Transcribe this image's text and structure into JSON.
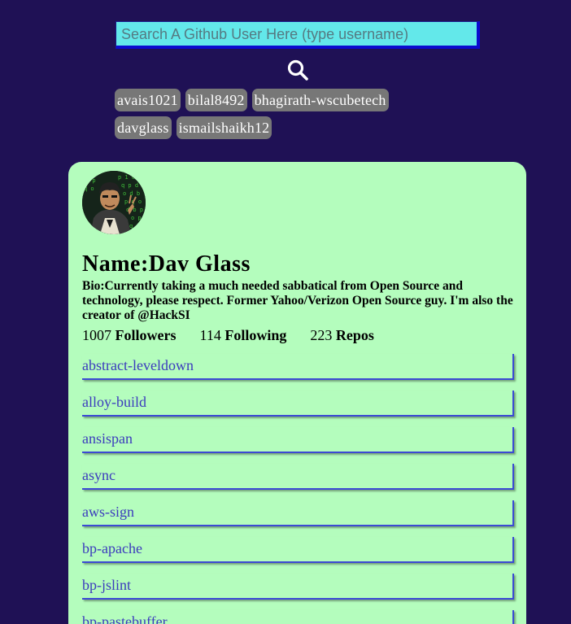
{
  "search": {
    "placeholder": "Search A Github User Here (type username)",
    "button_icon": "magnifier-icon"
  },
  "recent_searches": [
    [
      "avais1021",
      "bilal8492",
      "bhagirath-wscubetech"
    ],
    [
      "davglass",
      "ismailshaikh12"
    ]
  ],
  "profile": {
    "name": "Name:Dav Glass",
    "bio": "Bio:Currently taking a much needed sabbatical from Open Source and technology, please respect. Former Yahoo/Verizon Open Source guy. I'm also the creator of @HackSI",
    "followers_count": "1007",
    "followers_label": "Followers",
    "following_count": "114",
    "following_label": "Following",
    "repos_count": "223",
    "repos_label": "Repos"
  },
  "repos": [
    "abstract-leveldown",
    "alloy-build",
    "ansispan",
    "async",
    "aws-sign",
    "bp-apache",
    "bp-jslint",
    "bp-pastebuffer"
  ],
  "colors": {
    "background": "#1f1155",
    "search_bg": "#63e8ea",
    "chip_bg": "#777777",
    "card_bg": "#b4fdbd",
    "repo_link": "#3b3bbd"
  }
}
